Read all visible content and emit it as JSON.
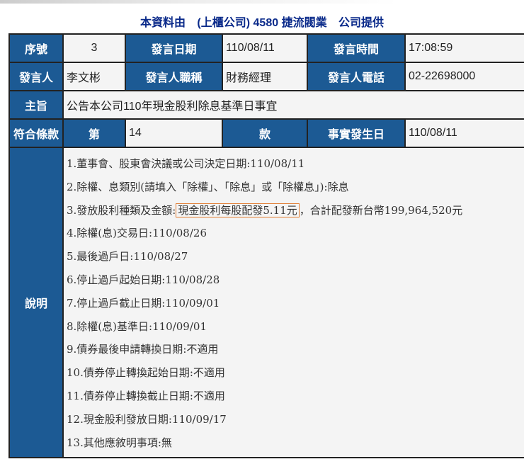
{
  "title": {
    "p1": "本資料由",
    "p2": "(上櫃公司) 4580 捷流閥業",
    "p3": "公司提供"
  },
  "row1": {
    "seq_label": "序號",
    "seq": "3",
    "date_label": "發言日期",
    "date": "110/08/11",
    "time_label": "發言時間",
    "time": "17:08:59"
  },
  "row2": {
    "speaker_label": "發言人",
    "speaker": "李文彬",
    "job_label": "發言人職稱",
    "job": "財務經理",
    "phone_label": "發言人電話",
    "phone": "02-22698000"
  },
  "row3": {
    "subject_label": "主旨",
    "subject": "公告本公司110年現金股利除息基準日事宜"
  },
  "row4": {
    "clause_label": "符合條款",
    "di": "第",
    "clause": "14",
    "kuan": "款",
    "fact_label": "事實發生日",
    "fact_date": "110/08/11"
  },
  "desc": {
    "label": "說明",
    "line3": {
      "pre": "3.發放股利種類及金額:",
      "highlight": "現金股利每股配發5.11元",
      "post": "，合計配發新台幣199,964,520元"
    },
    "lines": [
      "1.董事會、股東會決議或公司決定日期:110/08/11",
      "2.除權、息類別(請填入「除權」、「除息」或「除權息」):除息",
      "4.除權(息)交易日:110/08/26",
      "5.最後過戶日:110/08/27",
      "6.停止過戶起始日期:110/08/28",
      "7.停止過戶截止日期:110/09/01",
      "8.除權(息)基準日:110/09/01",
      "9.債券最後申請轉換日期:不適用",
      "10.債券停止轉換起始日期:不適用",
      "11.債券停止轉換截止日期:不適用",
      "12.現金股利發放日期:110/09/17",
      "13.其他應敘明事項:無"
    ]
  }
}
